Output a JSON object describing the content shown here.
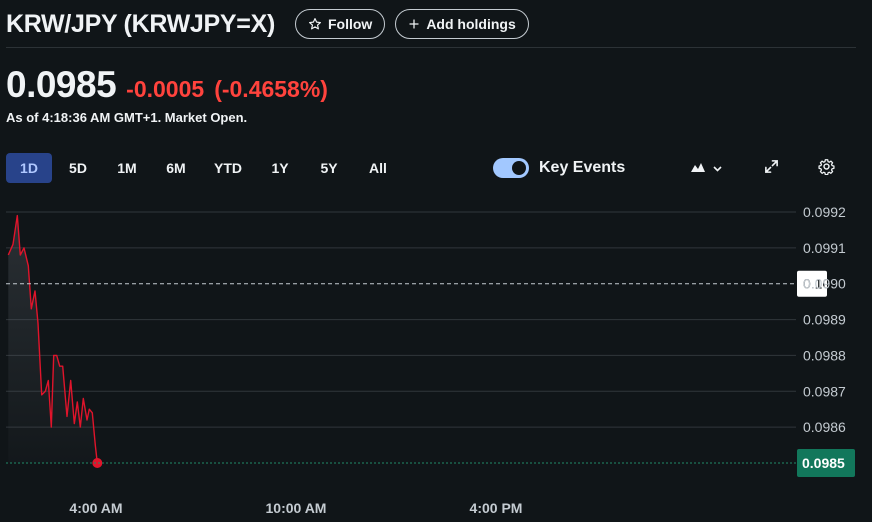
{
  "header": {
    "title": "KRW/JPY (KRWJPY=X)",
    "follow_label": "Follow",
    "add_holdings_label": "Add holdings",
    "follow_icon": "star-icon",
    "add_icon": "plus-icon"
  },
  "quote": {
    "price": "0.0985",
    "change": "-0.0005",
    "change_pct": "(-0.4658%)",
    "as_of": "As of 4:18:36 AM GMT+1. Market Open."
  },
  "ranges": [
    {
      "label": "1D",
      "active": true
    },
    {
      "label": "5D",
      "active": false
    },
    {
      "label": "1M",
      "active": false
    },
    {
      "label": "6M",
      "active": false
    },
    {
      "label": "YTD",
      "active": false
    },
    {
      "label": "1Y",
      "active": false
    },
    {
      "label": "5Y",
      "active": false
    },
    {
      "label": "All",
      "active": false
    }
  ],
  "controls": {
    "key_events_label": "Key Events",
    "key_events_on": true,
    "chart_type_icon": "mountain-chart-icon",
    "expand_icon": "expand-icon",
    "settings_icon": "gear-icon"
  },
  "colors": {
    "background": "#101518",
    "negative": "#ff433d",
    "line": "#e0142b",
    "active_range_bg": "#28438a",
    "current_price_box": "#12775b",
    "toggle": "#a2c8ff"
  },
  "chart_data": {
    "type": "line",
    "title": "",
    "xlabel": "",
    "ylabel": "",
    "y_ticks": [
      "0.0992",
      "0.0991",
      "0.0990",
      "0.0989",
      "0.0988",
      "0.0987",
      "0.0986"
    ],
    "ylim": [
      0.0985,
      0.0992
    ],
    "x_ticks": [
      "4:00 AM",
      "10:00 AM",
      "4:00 PM"
    ],
    "x_tick_hours": [
      4,
      10,
      16
    ],
    "xlim_hours": [
      1.3,
      25.0
    ],
    "previous_close": 0.099,
    "previous_close_label": "0.10",
    "current_price": 0.0985,
    "current_price_label": "0.0985",
    "grid": true,
    "series": [
      {
        "x": [
          1.37,
          1.51,
          1.64,
          1.73,
          1.84,
          1.97,
          2.06,
          2.17,
          2.26,
          2.37,
          2.48,
          2.57,
          2.66,
          2.73,
          2.82,
          2.91,
          3.0,
          3.13,
          3.24,
          3.35,
          3.44,
          3.53,
          3.62,
          3.73,
          3.8,
          3.89,
          3.98,
          4.04
        ],
        "y": [
          0.09908,
          0.09911,
          0.09919,
          0.09908,
          0.0991,
          0.09905,
          0.09893,
          0.09898,
          0.09889,
          0.09869,
          0.0987,
          0.09873,
          0.0986,
          0.0988,
          0.0988,
          0.09877,
          0.09877,
          0.09863,
          0.09873,
          0.09861,
          0.09867,
          0.0986,
          0.09868,
          0.09862,
          0.09865,
          0.09864,
          0.09855,
          0.0985
        ]
      }
    ]
  }
}
